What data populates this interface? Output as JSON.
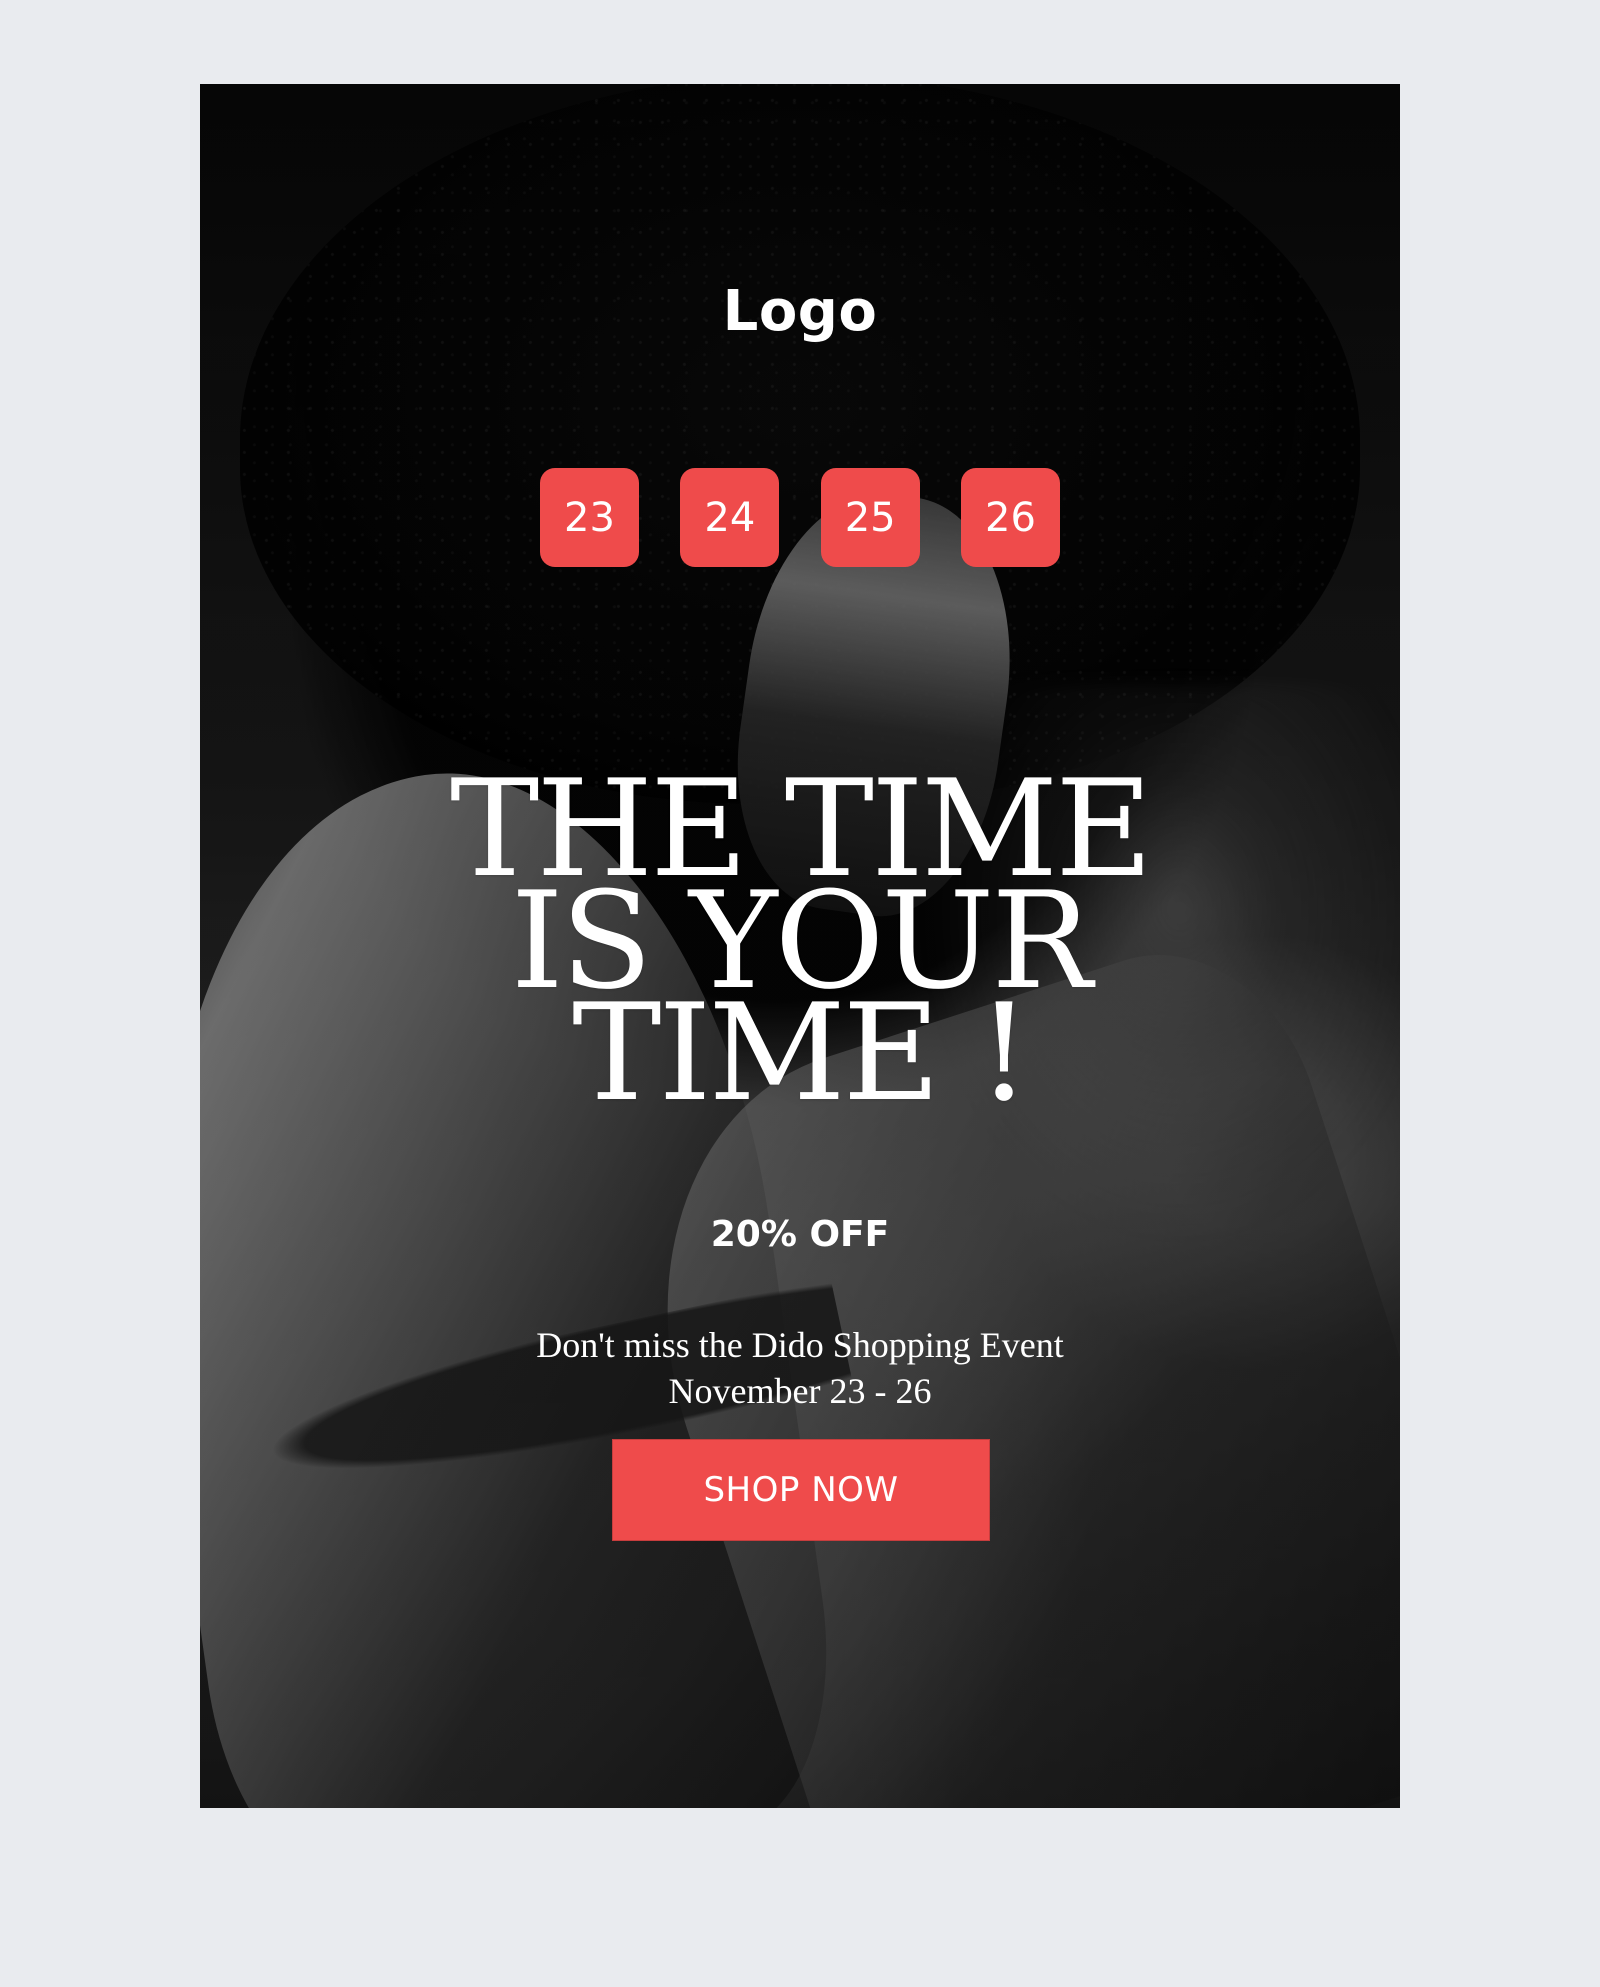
{
  "brand": {
    "logo": "Logo"
  },
  "dates": [
    "23",
    "24",
    "25",
    "26"
  ],
  "headline": {
    "line1": "THE TIME",
    "line2": "IS YOUR",
    "line3": "TIME !"
  },
  "promo": {
    "offer": "20% OFF",
    "event_line1": "Don't miss the Dido Shopping Event",
    "event_line2": "November 23 - 26",
    "cta_label": "SHOP NOW"
  },
  "colors": {
    "accent": "#ef4b4b",
    "background": "#e9ebef",
    "text": "#ffffff"
  }
}
